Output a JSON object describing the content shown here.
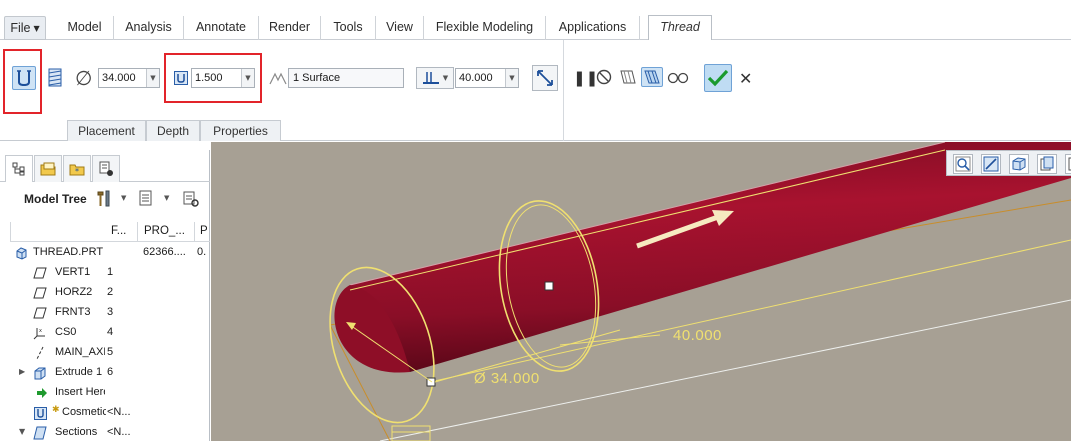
{
  "menu": {
    "file_label": "File",
    "tabs": [
      "Model",
      "Analysis",
      "Annotate",
      "Render",
      "Tools",
      "View",
      "Flexible Modeling",
      "Applications",
      "Thread"
    ],
    "active_tab": "Thread"
  },
  "ribbon": {
    "diameter_value": "34.000",
    "pitch_value": "1.500",
    "surface_value": "1 Surface",
    "depth_value": "40.000",
    "subtabs": [
      "Placement",
      "Depth",
      "Properties"
    ]
  },
  "model_tree": {
    "title": "Model Tree",
    "columns": [
      "F...",
      "PRO_...",
      "P"
    ],
    "rows": [
      {
        "label": "THREAD.PRT",
        "c2": "",
        "c3": "62366....",
        "c4": "0.",
        "icon": "part-icon",
        "indent": 0
      },
      {
        "label": "VERT1",
        "c2": "1",
        "c3": "",
        "c4": "",
        "icon": "datum-plane-icon",
        "indent": 1
      },
      {
        "label": "HORZ2",
        "c2": "2",
        "c3": "",
        "c4": "",
        "icon": "datum-plane-icon",
        "indent": 1
      },
      {
        "label": "FRNT3",
        "c2": "3",
        "c3": "",
        "c4": "",
        "icon": "datum-plane-icon",
        "indent": 1
      },
      {
        "label": "CS0",
        "c2": "4",
        "c3": "",
        "c4": "",
        "icon": "coordinate-system-icon",
        "indent": 1
      },
      {
        "label": "MAIN_AXIS",
        "c2": "5",
        "c3": "",
        "c4": "",
        "icon": "datum-axis-icon",
        "indent": 1
      },
      {
        "label": "Extrude 1",
        "c2": "6",
        "c3": "",
        "c4": "",
        "icon": "extrude-icon",
        "indent": 1,
        "expandable": true
      },
      {
        "label": "Insert Here",
        "c2": "",
        "c3": "",
        "c4": "",
        "icon": "insert-arrow-icon",
        "indent": 1
      },
      {
        "label": "Cosmetic",
        "c2": "<N...",
        "c3": "",
        "c4": "",
        "icon": "cosmetic-thread-icon",
        "indent": 1
      },
      {
        "label": "Sections",
        "c2": "<N...",
        "c3": "",
        "c4": "",
        "icon": "sections-icon",
        "indent": 1,
        "expanded": true
      }
    ]
  },
  "viewport": {
    "diameter_dim": "Ø 34.000",
    "depth_dim": "40.000"
  },
  "colors": {
    "accent_red": "#e2242a",
    "cylinder": "#9a0f2a",
    "graphics_bg": "#a7a094",
    "dimension_yellow": "#f0e070"
  }
}
